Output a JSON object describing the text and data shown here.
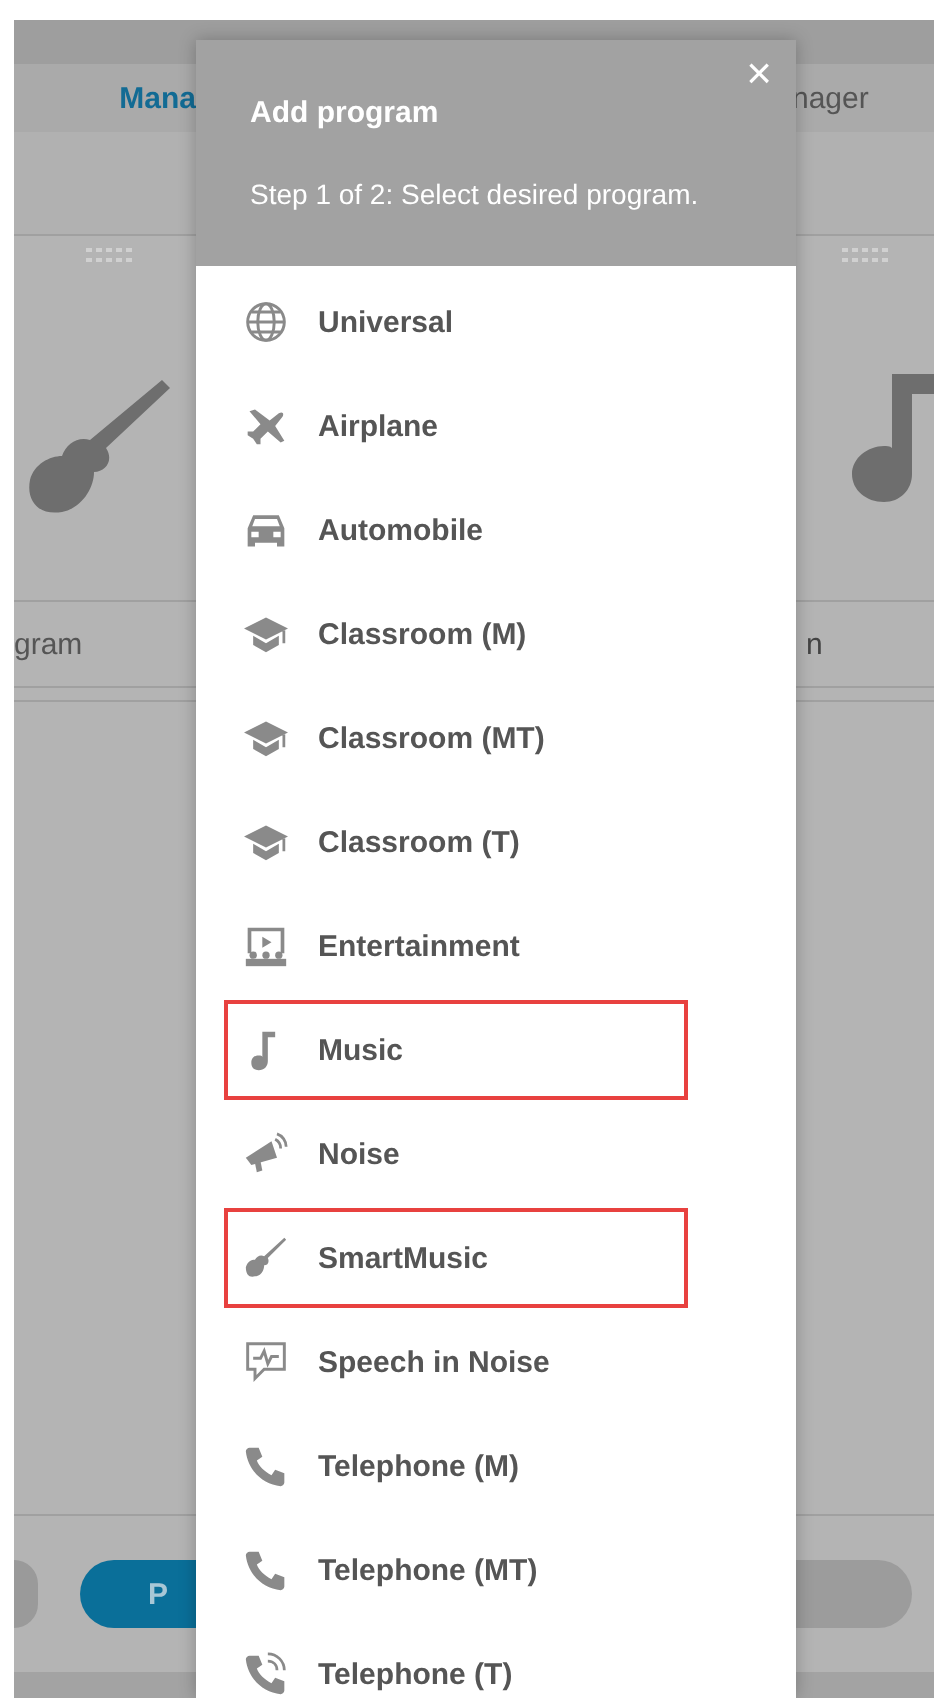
{
  "background": {
    "tab_left": "Mana",
    "tab_right": "nager",
    "row_left": "gram",
    "row_right": "n",
    "button_left": "P"
  },
  "dialog": {
    "close": "×",
    "title": "Add program",
    "subtitle": "Step 1 of 2: Select desired program.",
    "items": [
      {
        "label": "Universal",
        "kind": "globe",
        "highlighted": false
      },
      {
        "label": "Airplane",
        "kind": "airplane",
        "highlighted": false
      },
      {
        "label": "Automobile",
        "kind": "car",
        "highlighted": false
      },
      {
        "label": "Classroom (M)",
        "kind": "cap",
        "highlighted": false
      },
      {
        "label": "Classroom (MT)",
        "kind": "cap",
        "highlighted": false
      },
      {
        "label": "Classroom (T)",
        "kind": "cap",
        "highlighted": false
      },
      {
        "label": "Entertainment",
        "kind": "screen",
        "highlighted": false
      },
      {
        "label": "Music",
        "kind": "note",
        "highlighted": true
      },
      {
        "label": "Noise",
        "kind": "megaphone",
        "highlighted": false
      },
      {
        "label": "SmartMusic",
        "kind": "guitar",
        "highlighted": true
      },
      {
        "label": "Speech in Noise",
        "kind": "speech",
        "highlighted": false
      },
      {
        "label": "Telephone (M)",
        "kind": "phone",
        "highlighted": false
      },
      {
        "label": "Telephone (MT)",
        "kind": "phone",
        "highlighted": false
      },
      {
        "label": "Telephone (T)",
        "kind": "phone-loop",
        "highlighted": false
      }
    ]
  }
}
